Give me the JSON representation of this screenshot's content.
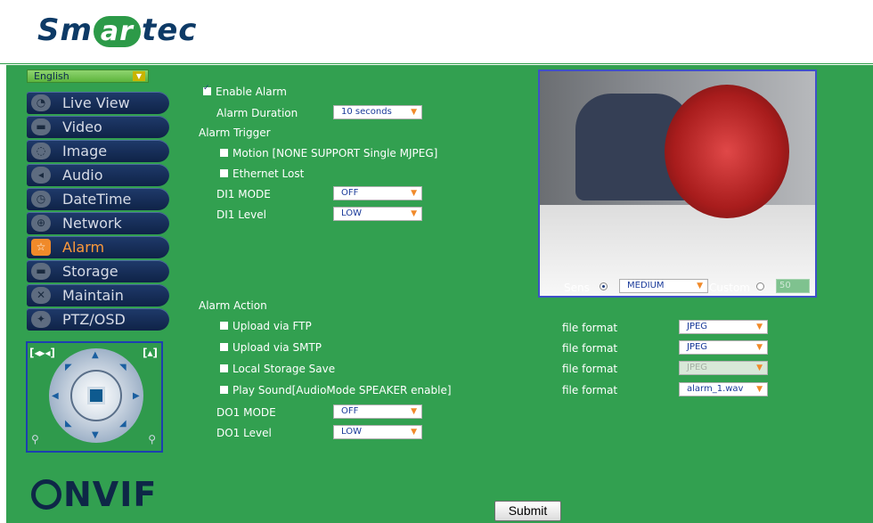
{
  "brand": {
    "logo_pre": "Sm",
    "logo_mid": "ar",
    "logo_post": "tec"
  },
  "language": {
    "selected": "English"
  },
  "nav": [
    {
      "label": "Live View",
      "icon": "chat-icon"
    },
    {
      "label": "Video",
      "icon": "camera-icon"
    },
    {
      "label": "Image",
      "icon": "image-icon"
    },
    {
      "label": "Audio",
      "icon": "speaker-icon"
    },
    {
      "label": "DateTime",
      "icon": "clock-icon"
    },
    {
      "label": "Network",
      "icon": "globe-icon"
    },
    {
      "label": "Alarm",
      "icon": "star-icon",
      "active": true
    },
    {
      "label": "Storage",
      "icon": "storage-icon"
    },
    {
      "label": "Maintain",
      "icon": "tools-icon"
    },
    {
      "label": "PTZ/OSD",
      "icon": "ptz-icon"
    }
  ],
  "ptz": {
    "zoom_out": "[◂▸◂]",
    "zoom_in": "[▴]"
  },
  "onvif": {
    "text": "NVIF"
  },
  "alarm": {
    "enable_label": "Enable Alarm",
    "duration_label": "Alarm Duration",
    "duration_value": "10 seconds",
    "trigger_label": "Alarm Trigger",
    "motion_label": "Motion [NONE SUPPORT Single MJPEG]",
    "ethernet_label": "Ethernet Lost",
    "di1_mode_label": "DI1 MODE",
    "di1_mode_value": "OFF",
    "di1_level_label": "DI1 Level",
    "di1_level_value": "LOW",
    "action_label": "Alarm Action",
    "ftp_label": "Upload via FTP",
    "smtp_label": "Upload via SMTP",
    "local_label": "Local Storage Save",
    "sound_label": "Play Sound[AudioMode SPEAKER enable]",
    "do1_mode_label": "DO1 MODE",
    "do1_mode_value": "OFF",
    "do1_level_label": "DO1 Level",
    "do1_level_value": "LOW",
    "file_format_label": "file format",
    "ftp_format": "JPEG",
    "smtp_format": "JPEG",
    "local_format": "JPEG",
    "sound_file": "alarm_1.wav"
  },
  "sens": {
    "label": "Sens",
    "value": "MEDIUM",
    "custom_label": "Custom",
    "custom_value": "50"
  },
  "submit_label": "Submit"
}
